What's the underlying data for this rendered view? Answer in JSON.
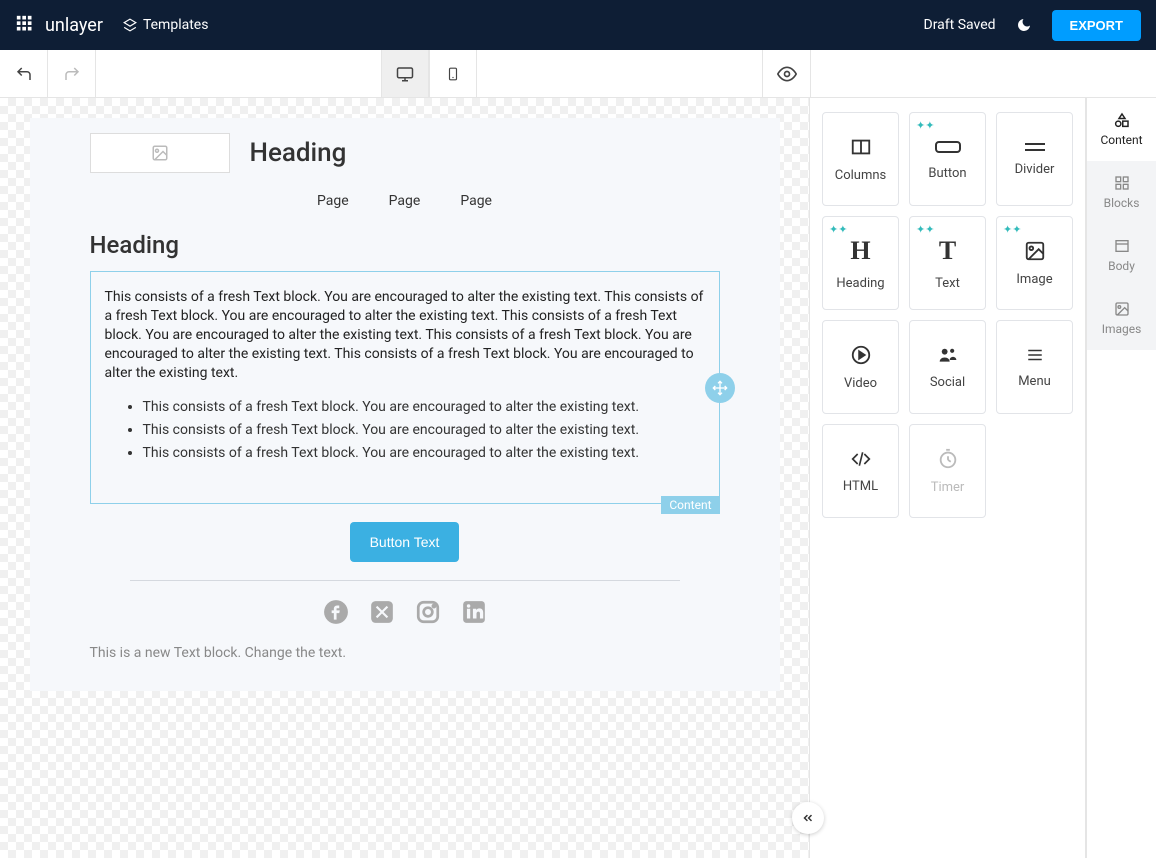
{
  "header": {
    "brand": "unlayer",
    "templates_label": "Templates",
    "draft_saved": "Draft Saved",
    "export_label": "EXPORT"
  },
  "device": {
    "desktop": "Desktop",
    "mobile": "Mobile",
    "preview": "Preview"
  },
  "canvas": {
    "heading_top": "Heading",
    "nav": [
      "Page",
      "Page",
      "Page"
    ],
    "heading_body": "Heading",
    "paragraph": "This consists of a fresh Text block. You are encouraged to alter the existing text. This consists of a fresh Text block. You are encouraged to alter the existing text. This consists of a fresh Text block. You are encouraged to alter the existing text. This consists of a fresh Text block. You are encouraged to alter the existing text. This consists of a fresh Text block. You are encouraged to alter the existing text.",
    "bullets": [
      "This consists of a fresh Text block. You are encouraged to alter the existing text.",
      "This consists of a fresh Text block. You are encouraged to alter the existing text.",
      "This consists of a fresh Text block. You are encouraged to alter the existing text."
    ],
    "selected_label": "Content",
    "button_label": "Button Text",
    "footer_text": "This is a new Text block. Change the text."
  },
  "blocks": [
    {
      "label": "Columns",
      "spark": false
    },
    {
      "label": "Button",
      "spark": true
    },
    {
      "label": "Divider",
      "spark": false
    },
    {
      "label": "Heading",
      "spark": true
    },
    {
      "label": "Text",
      "spark": true
    },
    {
      "label": "Image",
      "spark": true
    },
    {
      "label": "Video",
      "spark": false
    },
    {
      "label": "Social",
      "spark": false
    },
    {
      "label": "Menu",
      "spark": false
    },
    {
      "label": "HTML",
      "spark": false
    },
    {
      "label": "Timer",
      "spark": false,
      "disabled": true
    }
  ],
  "rail": [
    {
      "label": "Content",
      "active": true
    },
    {
      "label": "Blocks"
    },
    {
      "label": "Body"
    },
    {
      "label": "Images"
    }
  ],
  "colors": {
    "accent": "#009dff",
    "selection": "#8ed0ea",
    "header_bg": "#0e1e35"
  }
}
